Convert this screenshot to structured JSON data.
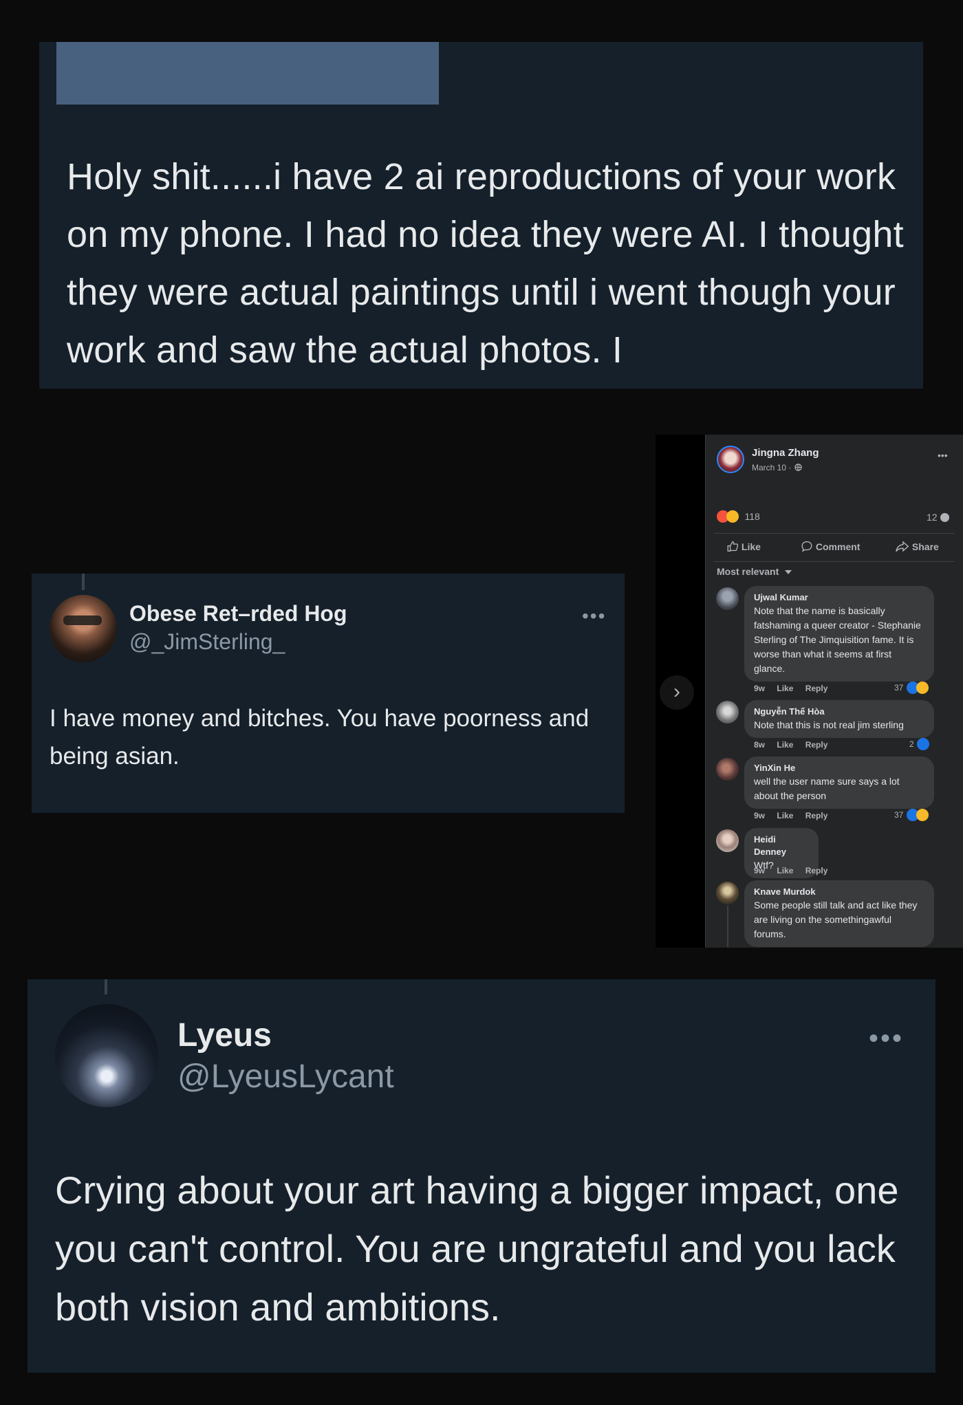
{
  "card1": {
    "text": "Holy shit......i have 2 ai reproductions of your work on my phone. I had no idea they were AI. I thought they were actual paintings until i went though your work and saw the actual photos. I"
  },
  "card2": {
    "display_name": "Obese Ret–rded Hog",
    "handle": "@_JimSterling_",
    "more": "•••",
    "text": "I have money and bitches. You have poorness and being asian."
  },
  "facebook": {
    "author": "Jingna Zhang",
    "date": "March 10 ·",
    "more": "•••",
    "reaction_count": "118",
    "comment_count": "12",
    "like_label": "Like",
    "comment_label": "Comment",
    "share_label": "Share",
    "sort_label": "Most relevant",
    "nav_arrow": "›",
    "comments": [
      {
        "name": "Ujwal Kumar",
        "text": "Note that the name is basically fatshaming a queer creator - Stephanie Sterling of The Jimquisition fame. It is worse than what it seems at first glance.",
        "time": "9w",
        "like": "Like",
        "reply": "Reply",
        "reactions": "37"
      },
      {
        "name": "Nguyễn Thế Hòa",
        "text": "Note that this is not real jim sterling",
        "time": "8w",
        "like": "Like",
        "reply": "Reply",
        "reactions": "2"
      },
      {
        "name": "YinXin He",
        "text": "well the user name sure says a lot about the person",
        "time": "9w",
        "like": "Like",
        "reply": "Reply",
        "reactions": "37"
      },
      {
        "name": "Heidi Denney",
        "text": "Wtf?",
        "time": "9w",
        "like": "Like",
        "reply": "Reply",
        "reactions": ""
      },
      {
        "name": "Knave Murdok",
        "text": "Some people still talk and act like they are living on the somethingawful forums.",
        "time": "",
        "like": "",
        "reply": "",
        "reactions": ""
      }
    ]
  },
  "card3": {
    "display_name": "Lyeus",
    "handle": "@LyeusLycant",
    "more": "•••",
    "text": "Crying about your art having a bigger impact, one you can't control. You are ungrateful and you lack both vision and ambitions."
  }
}
